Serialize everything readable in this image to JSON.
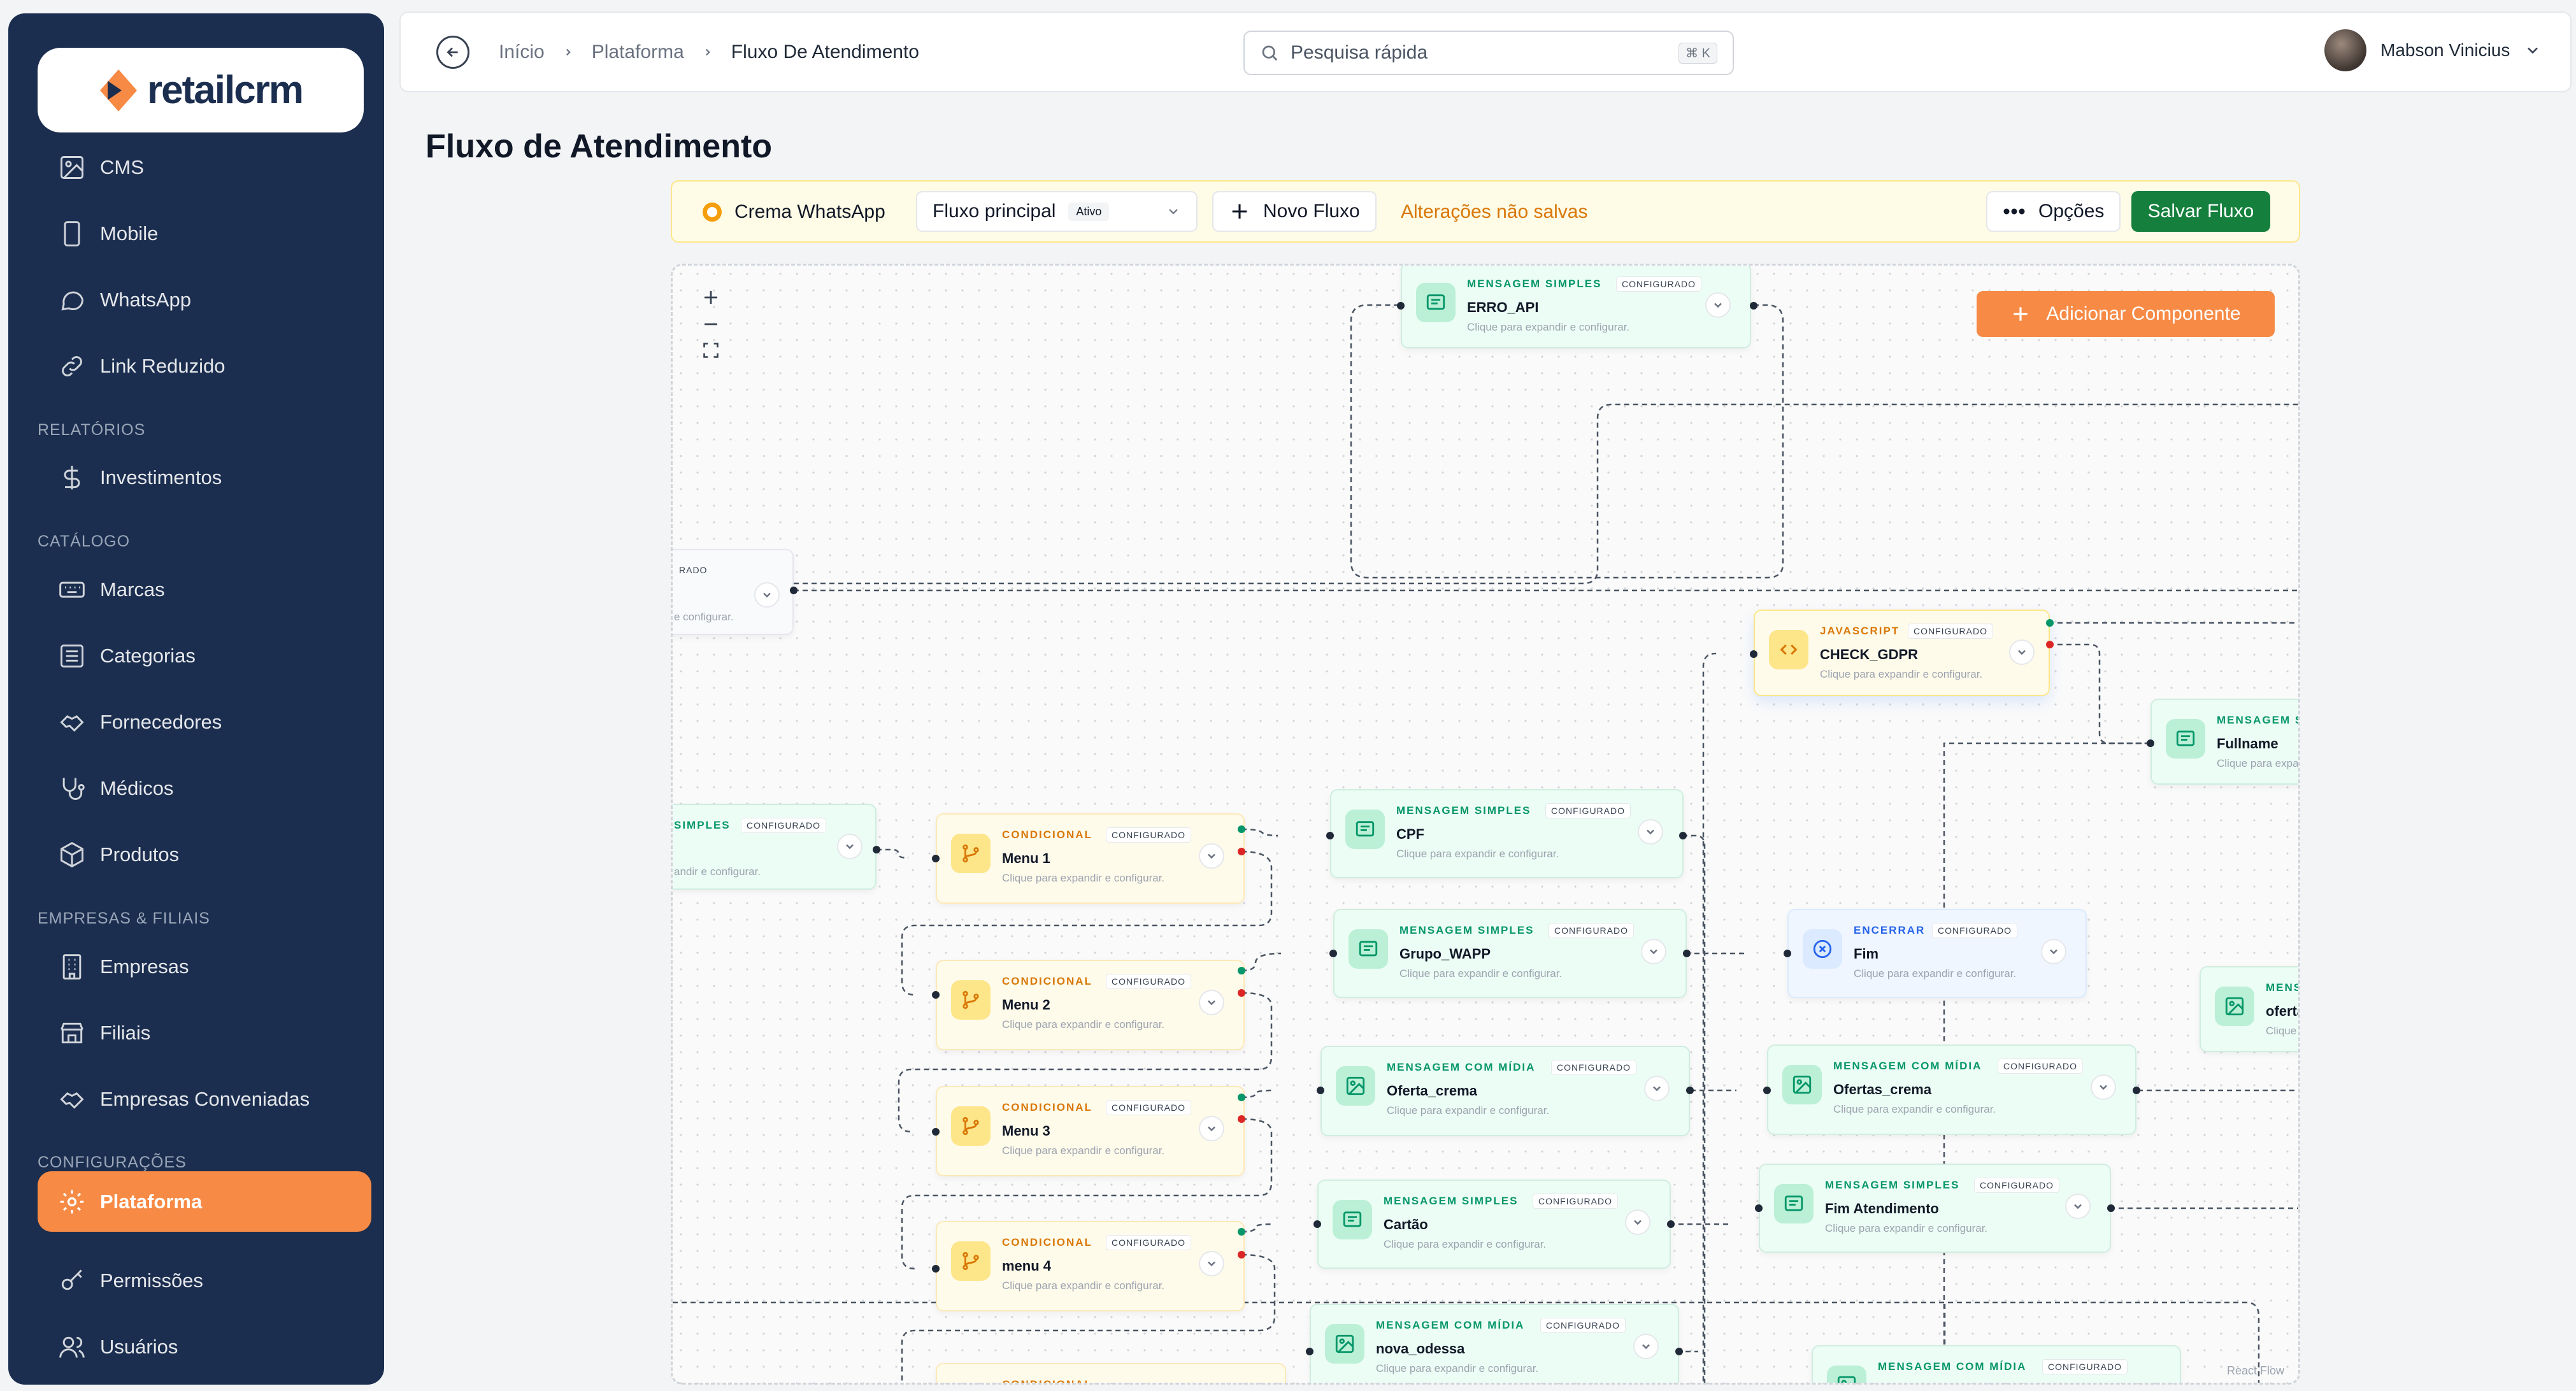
{
  "brand": {
    "logo_text": "retailcrm"
  },
  "sidebar": {
    "items": [
      {
        "label": "CMS",
        "icon": "image-icon"
      },
      {
        "label": "Mobile",
        "icon": "mobile-icon"
      },
      {
        "label": "WhatsApp",
        "icon": "chat-bubble-icon"
      },
      {
        "label": "Link Reduzido",
        "icon": "link-icon"
      },
      {
        "label": "Investimentos",
        "icon": "dollar-icon"
      },
      {
        "label": "Marcas",
        "icon": "keyboard-icon"
      },
      {
        "label": "Categorias",
        "icon": "list-icon"
      },
      {
        "label": "Fornecedores",
        "icon": "handshake-icon"
      },
      {
        "label": "Médicos",
        "icon": "stethoscope-icon"
      },
      {
        "label": "Produtos",
        "icon": "box-icon"
      },
      {
        "label": "Empresas",
        "icon": "building-icon"
      },
      {
        "label": "Filiais",
        "icon": "store-icon"
      },
      {
        "label": "Empresas Conveniadas",
        "icon": "handshake-icon"
      },
      {
        "label": "Plataforma",
        "icon": "gear-icon"
      },
      {
        "label": "Permissões",
        "icon": "key-icon"
      },
      {
        "label": "Usuários",
        "icon": "users-icon"
      }
    ],
    "sections": [
      "RELATÓRIOS",
      "CATÁLOGO",
      "EMPRESAS & FILIAIS",
      "CONFIGURAÇÕES"
    ],
    "active_color": "#f78a45"
  },
  "header": {
    "breadcrumb": [
      "Início",
      "Plataforma",
      "Fluxo De Atendimento"
    ],
    "search_placeholder": "Pesquisa rápida",
    "search_shortcut": "⌘ K",
    "user_name": "Mabson Vinicius"
  },
  "page": {
    "title": "Fluxo de Atendimento"
  },
  "toolbar": {
    "channel": "Crema WhatsApp",
    "flow_select": "Fluxo principal",
    "flow_status": "Ativo",
    "new_flow": "Novo Fluxo",
    "unsaved": "Alterações não salvas",
    "options": "Opções",
    "save": "Salvar Fluxo",
    "save_color": "#15803d"
  },
  "canvas": {
    "add_component": "Adicionar Componente",
    "watermark": "React Flow",
    "partial_texts": [
      "RADO",
      "e configurar.",
      "SIMPLES",
      "CONFIGURADO",
      "andir e configurar.",
      "MENSAGEM S",
      "Clique para expa",
      "MENS",
      "oferta",
      "Clique",
      "CONDICIONAL"
    ],
    "nodes": [
      {
        "type": "MENSAGEM SIMPLES",
        "badge": "CONFIGURADO",
        "name": "ERRO_API",
        "hint": "Clique para expandir e configurar."
      },
      {
        "type": "JAVASCRIPT",
        "badge": "CONFIGURADO",
        "name": "CHECK_GDPR",
        "hint": "Clique para expandir e configurar."
      },
      {
        "type": "MENSAGEM SIMPLES",
        "badge": "",
        "name": "Fullname",
        "hint": ""
      },
      {
        "type": "CONDICIONAL",
        "badge": "CONFIGURADO",
        "name": "Menu 1",
        "hint": "Clique para expandir e configurar."
      },
      {
        "type": "MENSAGEM SIMPLES",
        "badge": "CONFIGURADO",
        "name": "CPF",
        "hint": "Clique para expandir e configurar."
      },
      {
        "type": "CONDICIONAL",
        "badge": "CONFIGURADO",
        "name": "Menu 2",
        "hint": "Clique para expandir e configurar."
      },
      {
        "type": "MENSAGEM SIMPLES",
        "badge": "CONFIGURADO",
        "name": "Grupo_WAPP",
        "hint": "Clique para expandir e configurar."
      },
      {
        "type": "ENCERRAR",
        "badge": "CONFIGURADO",
        "name": "Fim",
        "hint": "Clique para expandir e configurar."
      },
      {
        "type": "CONDICIONAL",
        "badge": "CONFIGURADO",
        "name": "Menu 3",
        "hint": "Clique para expandir e configurar."
      },
      {
        "type": "MENSAGEM COM MÍDIA",
        "badge": "CONFIGURADO",
        "name": "Oferta_crema",
        "hint": "Clique para expandir e configurar."
      },
      {
        "type": "MENSAGEM COM MÍDIA",
        "badge": "CONFIGURADO",
        "name": "Ofertas_crema",
        "hint": "Clique para expandir e configurar."
      },
      {
        "type": "CONDICIONAL",
        "badge": "CONFIGURADO",
        "name": "menu 4",
        "hint": "Clique para expandir e configurar."
      },
      {
        "type": "MENSAGEM SIMPLES",
        "badge": "CONFIGURADO",
        "name": "Cartão",
        "hint": "Clique para expandir e configurar."
      },
      {
        "type": "MENSAGEM SIMPLES",
        "badge": "CONFIGURADO",
        "name": "Fim Atendimento",
        "hint": "Clique para expandir e configurar."
      },
      {
        "type": "MENSAGEM COM MÍDIA",
        "badge": "CONFIGURADO",
        "name": "nova_odessa",
        "hint": "Clique para expandir e configurar."
      },
      {
        "type": "MENSAGEM COM MÍDIA",
        "badge": "CONFIGURADO",
        "name": "",
        "hint": ""
      }
    ]
  }
}
